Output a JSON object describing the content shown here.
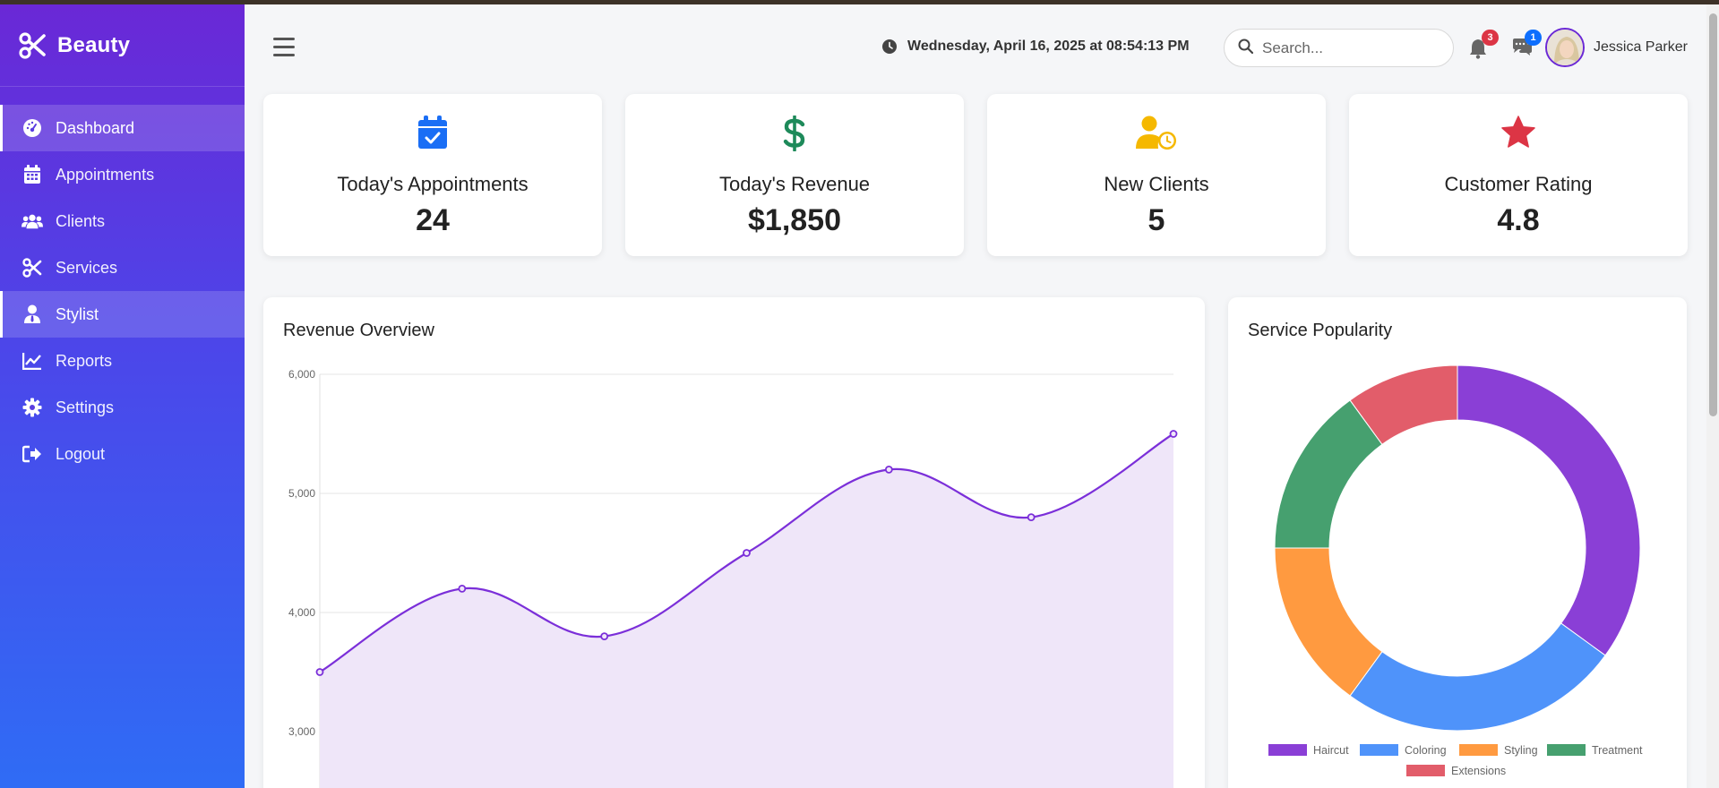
{
  "brand": {
    "name": "Beauty"
  },
  "sidebar": {
    "items": [
      {
        "label": "Dashboard",
        "icon": "gauge-icon",
        "active": true
      },
      {
        "label": "Appointments",
        "icon": "calendar-icon",
        "active": false
      },
      {
        "label": "Clients",
        "icon": "users-icon",
        "active": false
      },
      {
        "label": "Services",
        "icon": "scissors-icon",
        "active": false
      },
      {
        "label": "Stylist",
        "icon": "user-tie-icon",
        "active": true
      },
      {
        "label": "Reports",
        "icon": "line-chart-icon",
        "active": false
      },
      {
        "label": "Settings",
        "icon": "gear-icon",
        "active": false
      },
      {
        "label": "Logout",
        "icon": "logout-icon",
        "active": false
      }
    ]
  },
  "header": {
    "datetime": "Wednesday, April 16, 2025 at 08:54:13 PM",
    "search_placeholder": "Search...",
    "notifications_count": "3",
    "messages_count": "1",
    "user_name": "Jessica Parker"
  },
  "stats": [
    {
      "label": "Today's Appointments",
      "value": "24",
      "icon": "calendar-check-icon",
      "color": "#1a6ef5"
    },
    {
      "label": "Today's Revenue",
      "value": "$1,850",
      "icon": "dollar-icon",
      "color": "#1e8a5a"
    },
    {
      "label": "New Clients",
      "value": "5",
      "icon": "user-clock-icon",
      "color": "#f5b800"
    },
    {
      "label": "Customer Rating",
      "value": "4.8",
      "icon": "star-icon",
      "color": "#dc3545"
    }
  ],
  "revenue_panel": {
    "title": "Revenue Overview"
  },
  "popularity_panel": {
    "title": "Service Popularity"
  },
  "chart_data": [
    {
      "type": "area",
      "title": "Revenue Overview",
      "series": [
        {
          "values": [
            3500,
            4200,
            3800,
            4500,
            5200,
            4800,
            5500
          ]
        }
      ],
      "y_ticks": [
        "3,000",
        "4,000",
        "5,000",
        "6,000"
      ],
      "ylim": [
        2000,
        6000
      ],
      "grid": true,
      "line_color": "#7b2fd9",
      "fill_color": "#efe6f9"
    },
    {
      "type": "pie",
      "style": "doughnut",
      "title": "Service Popularity",
      "categories": [
        "Haircut",
        "Coloring",
        "Styling",
        "Treatment",
        "Extensions"
      ],
      "values": [
        35,
        25,
        15,
        15,
        10
      ],
      "colors": [
        "#8a3fd6",
        "#4f93fa",
        "#ff9a40",
        "#46a06f",
        "#e25d6a"
      ],
      "legend": "bottom"
    }
  ]
}
